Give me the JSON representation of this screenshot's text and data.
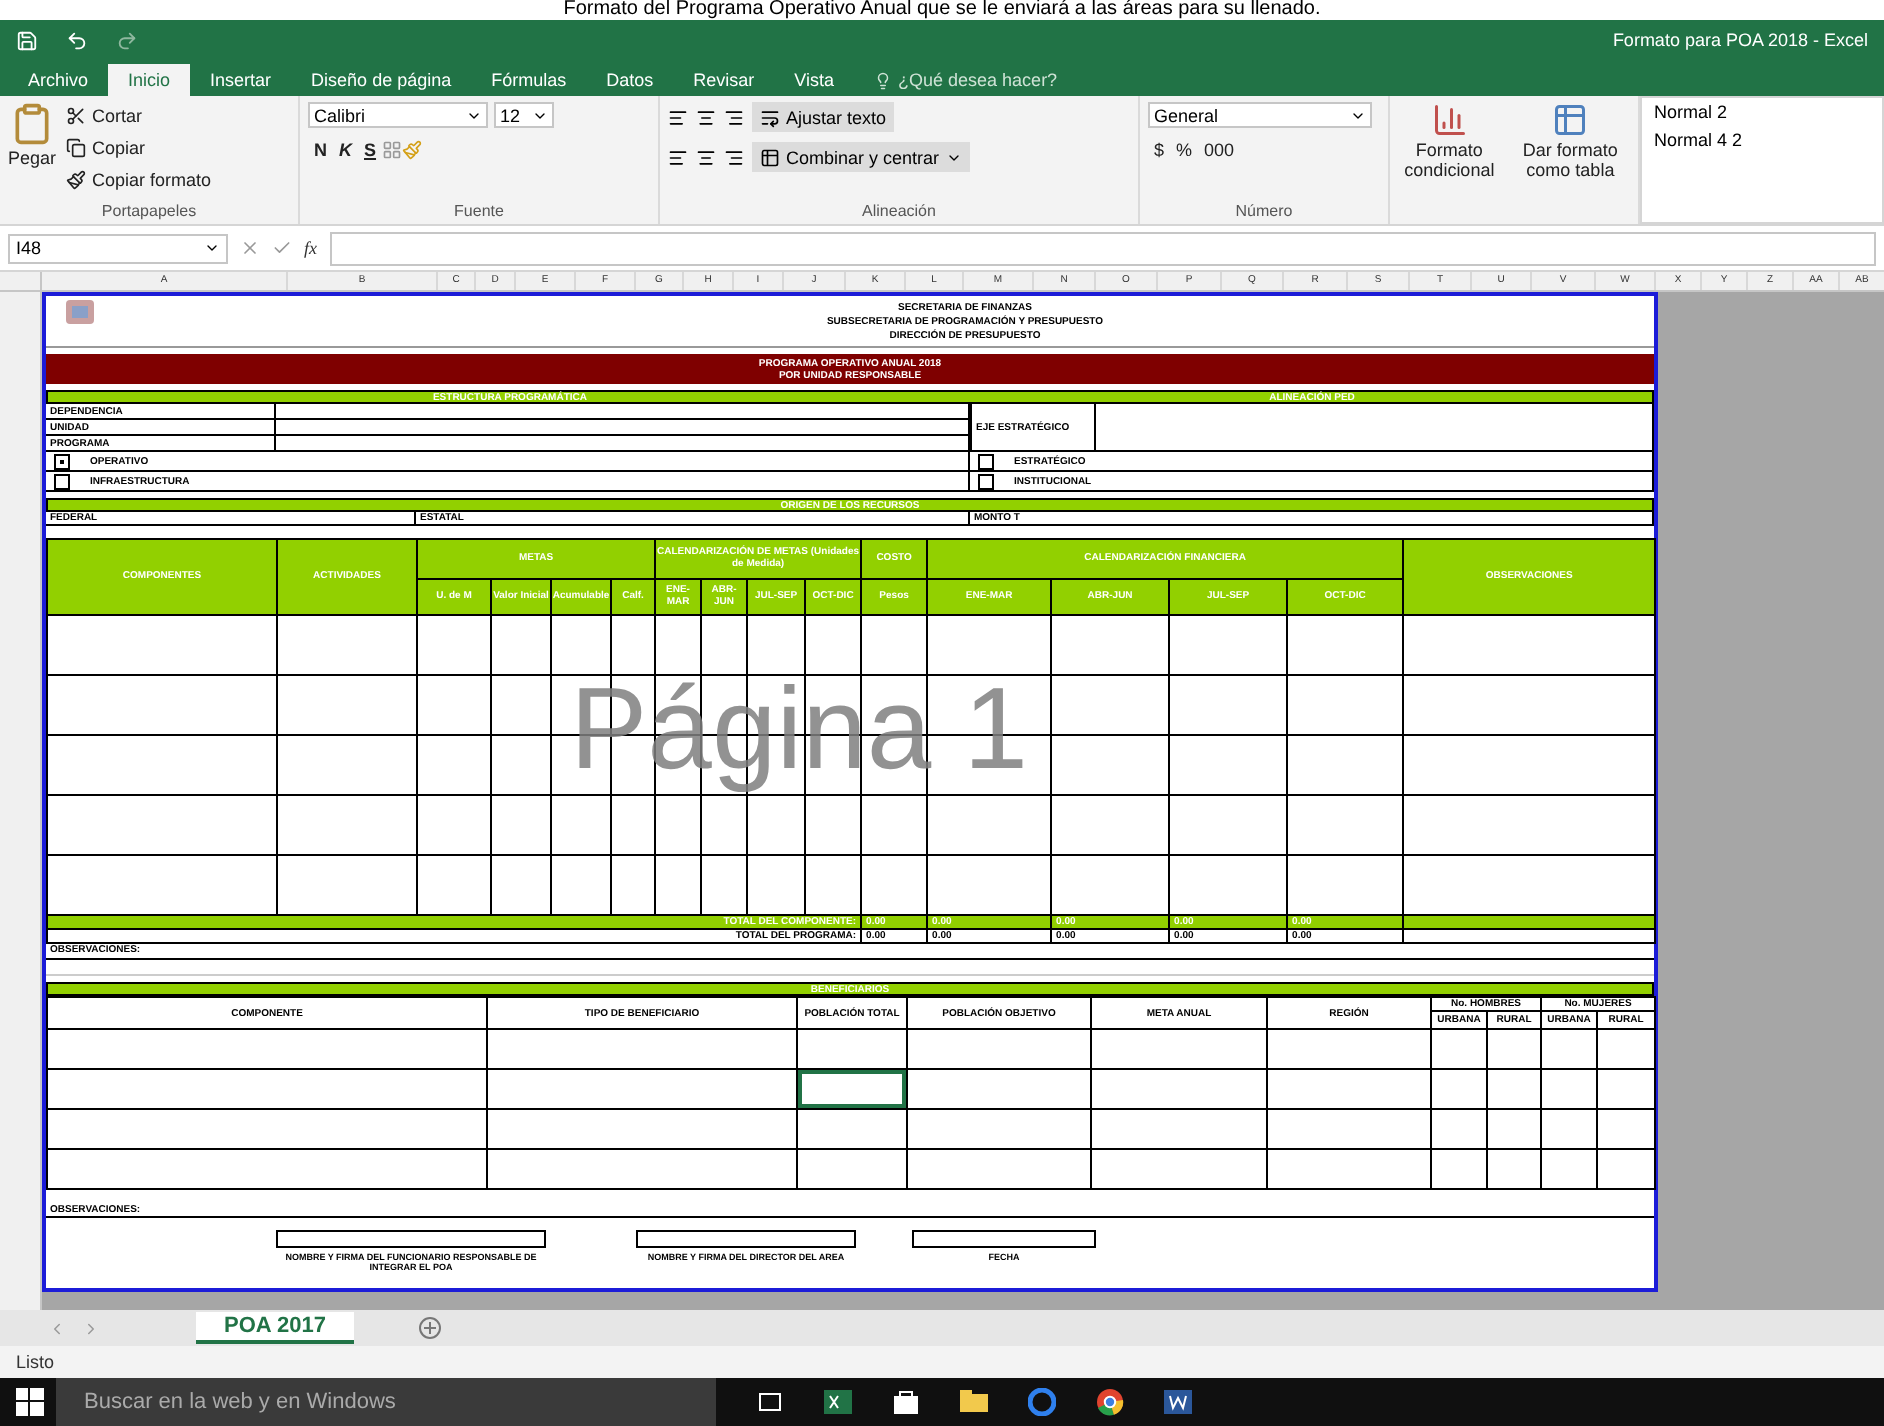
{
  "caption": "Formato del Programa Operativo Anual que se le enviará a las áreas para su llenado.",
  "window": {
    "title": "Formato para POA 2018 - Excel"
  },
  "ribbon_tabs": [
    {
      "label": "Archivo",
      "selected": false
    },
    {
      "label": "Inicio",
      "selected": true
    },
    {
      "label": "Insertar",
      "selected": false
    },
    {
      "label": "Diseño de página",
      "selected": false
    },
    {
      "label": "Fórmulas",
      "selected": false
    },
    {
      "label": "Datos",
      "selected": false
    },
    {
      "label": "Revisar",
      "selected": false
    },
    {
      "label": "Vista",
      "selected": false
    }
  ],
  "tell_me": {
    "placeholder": "¿Qué desea hacer?"
  },
  "ribbon": {
    "clipboard": {
      "paste": "Pegar",
      "cut": "Cortar",
      "copy": "Copiar",
      "format_painter": "Copiar formato",
      "group": "Portapapeles"
    },
    "font": {
      "name": "Calibri",
      "size": "12",
      "bold": "N",
      "italic": "K",
      "underline": "S",
      "group": "Fuente"
    },
    "alignment": {
      "wrap": "Ajustar texto",
      "merge": "Combinar y centrar",
      "group": "Alineación"
    },
    "number": {
      "format": "General",
      "currency": "$",
      "percent": "%",
      "thousands": "000",
      "group": "Número"
    },
    "styles": {
      "conditional": "Formato condicional",
      "table": "Dar formato como tabla",
      "cell_styles": [
        "Normal 2",
        "Normal 4 2"
      ]
    }
  },
  "formula_bar": {
    "name_box": "I48",
    "fx": "fx"
  },
  "columns": [
    "A",
    "B",
    "C",
    "D",
    "E",
    "F",
    "G",
    "H",
    "I",
    "J",
    "K",
    "L",
    "M",
    "N",
    "O",
    "P",
    "Q",
    "R",
    "S",
    "T",
    "U",
    "V",
    "W",
    "X",
    "Y",
    "Z",
    "AA",
    "AB"
  ],
  "sheet": {
    "header_lines": [
      "SECRETARIA DE FINANZAS",
      "SUBSECRETARIA DE PROGRAMACIÓN Y PRESUPUESTO",
      "DIRECCIÓN DE PRESUPUESTO"
    ],
    "banner_lines": [
      "PROGRAMA OPERATIVO ANUAL 2018",
      "POR UNIDAD RESPONSABLE"
    ],
    "structure_title": "ESTRUCTURA PROGRAMÁTICA",
    "alignment_title": "ALINEACIÓN PED",
    "structure_fields": [
      "DEPENDENCIA",
      "UNIDAD",
      "PROGRAMA"
    ],
    "axis_label": "EJE ESTRATÉGICO",
    "left_checks": [
      {
        "label": "OPERATIVO",
        "checked": true
      },
      {
        "label": "INFRAESTRUCTURA",
        "checked": false
      }
    ],
    "right_checks": [
      {
        "label": "ESTRATÉGICO",
        "checked": false
      },
      {
        "label": "INSTITUCIONAL",
        "checked": false
      }
    ],
    "resources_title": "ORIGEN DE LOS RECURSOS",
    "resources": [
      "FEDERAL",
      "ESTATAL",
      "MONTO T"
    ],
    "main_headers": {
      "components": "COMPONENTES",
      "activities": "ACTIVIDADES",
      "goals": "METAS",
      "goal_cols": [
        "U. de M",
        "Valor Inicial",
        "Acumulable",
        "Calf."
      ],
      "goal_calendar": "CALENDARIZACIÓN DE METAS (Unidades de Medida)",
      "quarters": [
        "ENE-MAR",
        "ABR-JUN",
        "JUL-SEP",
        "OCT-DIC"
      ],
      "cost": "COSTO",
      "cost_unit": "Pesos",
      "finance_calendar": "CALENDARIZACIÓN FINANCIERA",
      "finance_quarters": [
        "ENE-MAR",
        "ABR-JUN",
        "JUL-SEP",
        "OCT-DIC"
      ],
      "observations": "OBSERVACIONES"
    },
    "totals": [
      {
        "label": "TOTAL DEL COMPONENTE:",
        "values": [
          "0.00",
          "0.00",
          "0.00",
          "0.00",
          "0.00"
        ],
        "kind": "highlight"
      },
      {
        "label": "TOTAL DEL PROGRAMA:",
        "values": [
          "0.00",
          "0.00",
          "0.00",
          "0.00",
          "0.00"
        ],
        "kind": "plain"
      }
    ],
    "observations_label": "OBSERVACIONES:",
    "beneficiaries_title": "BENEFICIARIOS",
    "beneficiary_headers": {
      "component": "COMPONENTE",
      "type": "TIPO DE BENEFICIARIO",
      "total": "POBLACIÓN TOTAL",
      "target": "POBLACIÓN OBJETIVO",
      "goal": "META ANUAL",
      "region": "REGIÓN",
      "men": "No. HOMBRES",
      "women": "No. MUJERES",
      "men_cols": [
        "URBANA",
        "RURAL"
      ],
      "women_cols": [
        "URBANA",
        "RURAL"
      ]
    },
    "beneficiary_rows": [
      {
        "cells": [
          {
            "selected": false
          },
          {
            "selected": false
          },
          {
            "selected": false
          },
          {
            "selected": false
          },
          {
            "selected": false
          },
          {
            "selected": false
          },
          {
            "selected": false
          },
          {
            "selected": false
          },
          {
            "selected": false
          },
          {
            "selected": false
          }
        ]
      },
      {
        "cells": [
          {
            "selected": false
          },
          {
            "selected": false
          },
          {
            "selected": true
          },
          {
            "selected": false
          },
          {
            "selected": false
          },
          {
            "selected": false
          },
          {
            "selected": false
          },
          {
            "selected": false
          },
          {
            "selected": false
          },
          {
            "selected": false
          }
        ]
      },
      {
        "cells": [
          {
            "selected": false
          },
          {
            "selected": false
          },
          {
            "selected": false
          },
          {
            "selected": false
          },
          {
            "selected": false
          },
          {
            "selected": false
          },
          {
            "selected": false
          },
          {
            "selected": false
          },
          {
            "selected": false
          },
          {
            "selected": false
          }
        ]
      },
      {
        "cells": [
          {
            "selected": false
          },
          {
            "selected": false
          },
          {
            "selected": false
          },
          {
            "selected": false
          },
          {
            "selected": false
          },
          {
            "selected": false
          },
          {
            "selected": false
          },
          {
            "selected": false
          },
          {
            "selected": false
          },
          {
            "selected": false
          }
        ]
      }
    ],
    "observations_label_2": "OBSERVACIONES:",
    "signatures": [
      "NOMBRE Y FIRMA DEL FUNCIONARIO RESPONSABLE DE INTEGRAR EL POA",
      "NOMBRE Y FIRMA DEL DIRECTOR DEL AREA",
      "FECHA"
    ]
  },
  "page_label": "Página 1",
  "sheet_tabs": [
    {
      "label": "POA 2017",
      "selected": true
    }
  ],
  "status": "Listo",
  "taskbar": {
    "search": {
      "placeholder": "Buscar en la web y en Windows"
    }
  }
}
